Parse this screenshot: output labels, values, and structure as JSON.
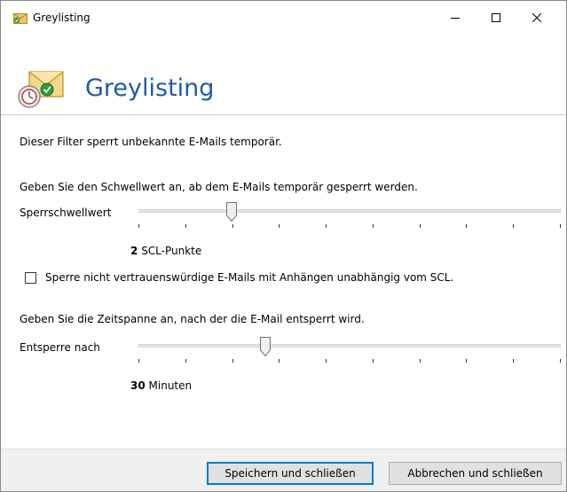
{
  "window": {
    "title": "Greylisting",
    "controls": {
      "minimize": "minimize",
      "maximize": "maximize",
      "close": "close"
    }
  },
  "header": {
    "title": "Greylisting",
    "icon": "envelope-check-icon"
  },
  "description": "Dieser Filter sperrt unbekannte E-Mails temporär.",
  "scl": {
    "instruction": "Geben Sie den Schwellwert an, ab dem E-Mails temporär gesperrt werden.",
    "label": "Sperrschwellwert",
    "value": "2",
    "unit": "SCL-Punkte",
    "level": 0.22,
    "tick_count": 10
  },
  "checkbox": {
    "label": "Sperre nicht vertrauenswürdige E-Mails mit Anhängen unabhängig vom SCL.",
    "checked": false
  },
  "release": {
    "instruction": "Geben Sie die Zeitspanne an, nach der die E-Mail entsperrt wird.",
    "label": "Entsperre nach",
    "value": "30",
    "unit": "Minuten",
    "level": 0.3,
    "tick_count": 10
  },
  "footer": {
    "save_label": "Speichern und schließen",
    "cancel_label": "Abbrechen und schließen"
  },
  "colors": {
    "title_blue": "#1e5aa8",
    "footer_bg": "#f0f0f0",
    "accent": "#0078d7"
  }
}
